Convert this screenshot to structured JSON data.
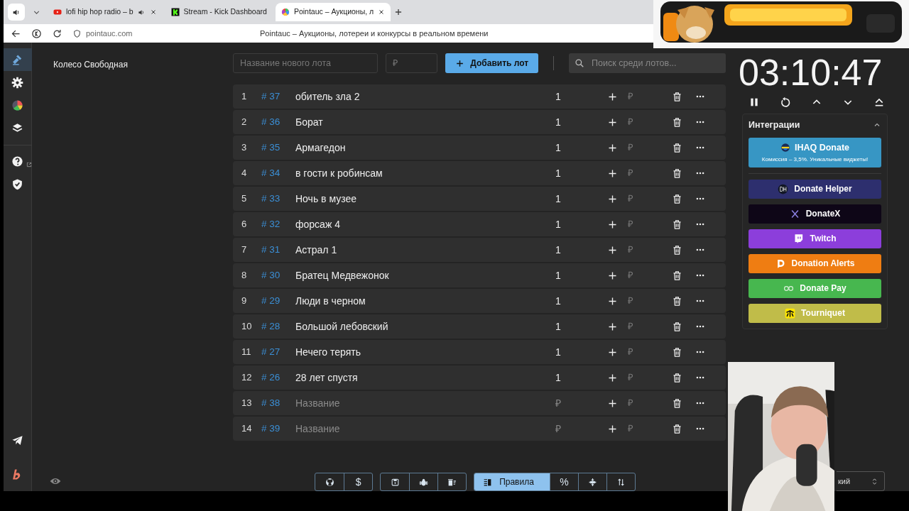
{
  "browser": {
    "tabs": [
      {
        "title": "lofi hip hop radio – b",
        "audio": true,
        "selected": false
      },
      {
        "title": "Stream - Kick Dashboard",
        "audio": false,
        "selected": false
      },
      {
        "title": "Pointauc – Аукционы, л",
        "audio": false,
        "selected": true
      }
    ],
    "address": "pointauc.com",
    "page_title": "Pointauc – Аукционы, лотереи и конкурсы в реальном времени"
  },
  "sidebar": {
    "groups": [
      [
        {
          "selected": true
        },
        {
          "selected": false
        },
        {
          "selected": false
        },
        {
          "selected": false
        }
      ],
      [
        {
          "selected": false
        },
        {
          "selected": false
        }
      ]
    ]
  },
  "wheel_title": "Колесо Свободная",
  "toolbar": {
    "name_placeholder": "Название нового лота",
    "amount_placeholder": "₽",
    "add_button": "Добавить лот",
    "search_placeholder": "Поиск среди лотов..."
  },
  "lots": [
    {
      "index": "1",
      "id": "# 37",
      "name": "обитель зла 2",
      "amount": "1",
      "add_placeholder": "₽"
    },
    {
      "index": "2",
      "id": "# 36",
      "name": "Борат",
      "amount": "1",
      "add_placeholder": "₽"
    },
    {
      "index": "3",
      "id": "# 35",
      "name": "Армагедон",
      "amount": "1",
      "add_placeholder": "₽"
    },
    {
      "index": "4",
      "id": "# 34",
      "name": "в гости к робинсам",
      "amount": "1",
      "add_placeholder": "₽"
    },
    {
      "index": "5",
      "id": "# 33",
      "name": "Ночь в музее",
      "amount": "1",
      "add_placeholder": "₽"
    },
    {
      "index": "6",
      "id": "# 32",
      "name": "форсаж 4",
      "amount": "1",
      "add_placeholder": "₽"
    },
    {
      "index": "7",
      "id": "# 31",
      "name": "Астрал 1",
      "amount": "1",
      "add_placeholder": "₽"
    },
    {
      "index": "8",
      "id": "# 30",
      "name": "Братец Медвежонок",
      "amount": "1",
      "add_placeholder": "₽"
    },
    {
      "index": "9",
      "id": "# 29",
      "name": "Люди в черном",
      "amount": "1",
      "add_placeholder": "₽"
    },
    {
      "index": "10",
      "id": "# 28",
      "name": "Большой лебовский",
      "amount": "1",
      "add_placeholder": "₽"
    },
    {
      "index": "11",
      "id": "# 27",
      "name": "Нечего терять",
      "amount": "1",
      "add_placeholder": "₽"
    },
    {
      "index": "12",
      "id": "# 26",
      "name": "28 лет спустя",
      "amount": "1",
      "add_placeholder": "₽"
    },
    {
      "index": "13",
      "id": "# 38",
      "name_placeholder": "Название",
      "amount_placeholder": "₽",
      "add_placeholder": "₽"
    },
    {
      "index": "14",
      "id": "# 39",
      "name_placeholder": "Название",
      "amount_placeholder": "₽",
      "add_placeholder": "₽"
    }
  ],
  "bottom_toolbar": [
    [
      {
        "selected": false
      },
      {
        "label": "$",
        "selected": false
      }
    ],
    [
      {
        "selected": false
      },
      {
        "selected": false
      },
      {
        "selected": false
      }
    ],
    [
      {
        "label": "Правила",
        "selected": true
      },
      {
        "label": "%",
        "selected": false
      },
      {
        "selected": false
      },
      {
        "selected": false
      }
    ]
  ],
  "timer": {
    "time": "03:10:47"
  },
  "integrations": {
    "title": "Интеграции",
    "expanded": true,
    "featured": {
      "name": "IHAQ Donate",
      "subtitle": "Комиссия – 3,5%. Уникальные виджеты!",
      "color": "#3796c4"
    },
    "items": [
      {
        "name": "Donate Helper",
        "color": "#2d2f6e"
      },
      {
        "name": "DonateX",
        "color": "#0e0617"
      },
      {
        "name": "Twitch",
        "color": "#8c3edb"
      },
      {
        "name": "Donation Alerts",
        "color": "#ef7d12"
      },
      {
        "name": "Donate Pay",
        "color": "#47b74f"
      },
      {
        "name": "Tourniquet",
        "color": "#c0bc49"
      }
    ]
  },
  "language_select": "кий"
}
